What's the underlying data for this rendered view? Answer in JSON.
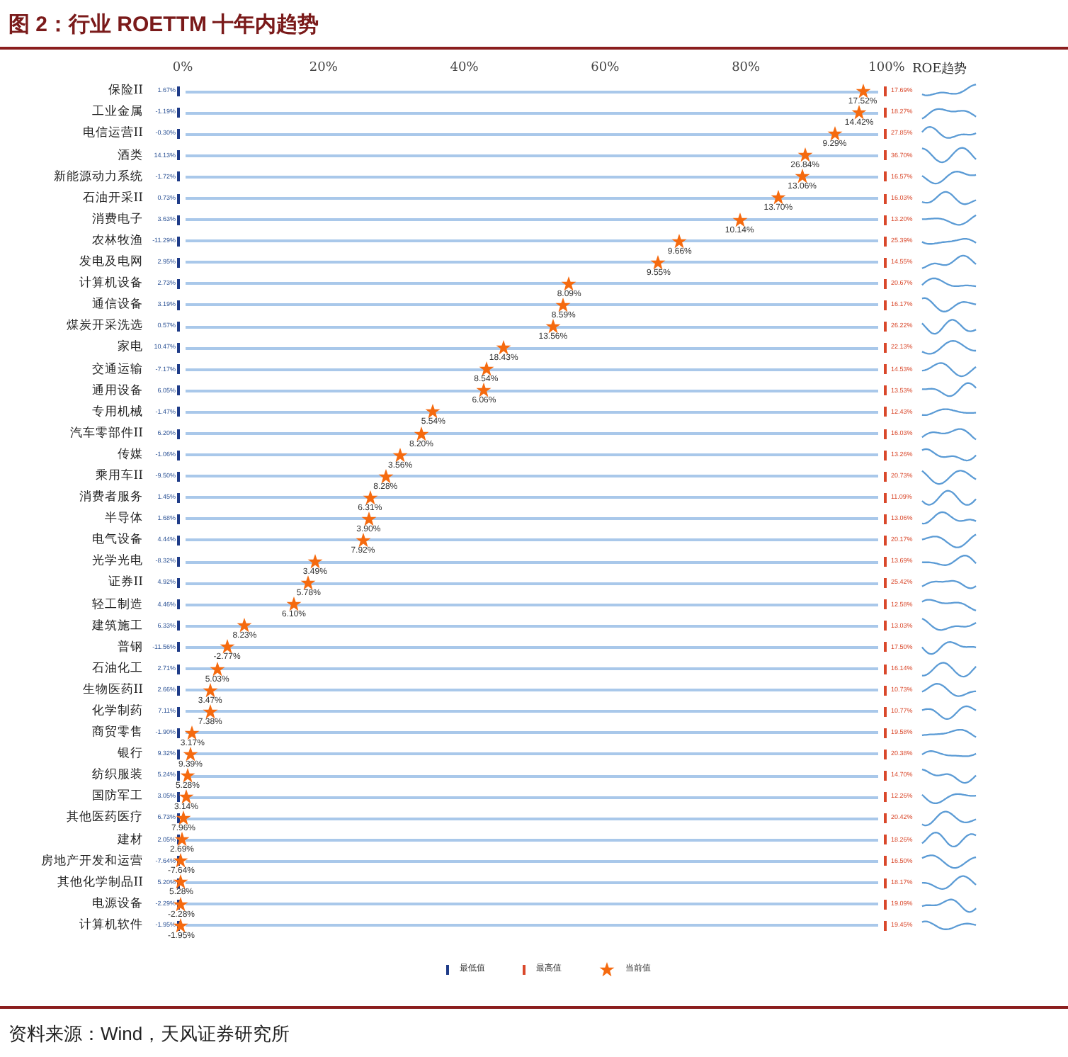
{
  "title": "图 2：行业 ROETTM 十年内趋势",
  "axis_ticks": [
    "0%",
    "20%",
    "40%",
    "60%",
    "80%",
    "100%"
  ],
  "trend_header": "ROE趋势",
  "rows": [
    {
      "name": "保险II",
      "min": "1.67%",
      "max": "17.69%",
      "level": 0.97,
      "current": "17.52%"
    },
    {
      "name": "工业金属",
      "min": "-1.19%",
      "max": "18.27%",
      "level": 0.965,
      "current": "14.42%"
    },
    {
      "name": "电信运营II",
      "min": "-0.30%",
      "max": "27.85%",
      "level": 0.93,
      "current": "9.29%"
    },
    {
      "name": "酒类",
      "min": "14.13%",
      "max": "36.70%",
      "level": 0.888,
      "current": "26.84%"
    },
    {
      "name": "新能源动力系统",
      "min": "-1.72%",
      "max": "16.57%",
      "level": 0.884,
      "current": "13.06%"
    },
    {
      "name": "石油开采II",
      "min": "0.73%",
      "max": "16.03%",
      "level": 0.85,
      "current": "13.70%"
    },
    {
      "name": "消费电子",
      "min": "3.63%",
      "max": "13.20%",
      "level": 0.795,
      "current": "10.14%"
    },
    {
      "name": "农林牧渔",
      "min": "-11.29%",
      "max": "25.39%",
      "level": 0.71,
      "current": "9.66%"
    },
    {
      "name": "发电及电网",
      "min": "2.95%",
      "max": "14.55%",
      "level": 0.68,
      "current": "9.55%"
    },
    {
      "name": "计算机设备",
      "min": "2.73%",
      "max": "20.67%",
      "level": 0.553,
      "current": "8.09%"
    },
    {
      "name": "通信设备",
      "min": "3.19%",
      "max": "16.17%",
      "level": 0.545,
      "current": "8.59%"
    },
    {
      "name": "煤炭开采洗选",
      "min": "0.57%",
      "max": "26.22%",
      "level": 0.53,
      "current": "13.56%"
    },
    {
      "name": "家电",
      "min": "10.47%",
      "max": "22.13%",
      "level": 0.46,
      "current": "18.43%"
    },
    {
      "name": "交通运输",
      "min": "-7.17%",
      "max": "14.53%",
      "level": 0.435,
      "current": "8.54%"
    },
    {
      "name": "通用设备",
      "min": "6.05%",
      "max": "13.53%",
      "level": 0.432,
      "current": "6.06%"
    },
    {
      "name": "专用机械",
      "min": "-1.47%",
      "max": "12.43%",
      "level": 0.36,
      "current": "5.54%"
    },
    {
      "name": "汽车零部件II",
      "min": "6.20%",
      "max": "16.03%",
      "level": 0.343,
      "current": "8.20%"
    },
    {
      "name": "传媒",
      "min": "-1.06%",
      "max": "13.26%",
      "level": 0.313,
      "current": "3.56%"
    },
    {
      "name": "乘用车II",
      "min": "-9.50%",
      "max": "20.73%",
      "level": 0.292,
      "current": "8.28%"
    },
    {
      "name": "消费者服务",
      "min": "1.45%",
      "max": "11.09%",
      "level": 0.27,
      "current": "6.31%"
    },
    {
      "name": "半导体",
      "min": "1.68%",
      "max": "13.06%",
      "level": 0.268,
      "current": "3.90%"
    },
    {
      "name": "电气设备",
      "min": "4.44%",
      "max": "20.17%",
      "level": 0.26,
      "current": "7.92%"
    },
    {
      "name": "光学光电",
      "min": "-8.32%",
      "max": "13.69%",
      "level": 0.192,
      "current": "3.49%"
    },
    {
      "name": "证券II",
      "min": "4.92%",
      "max": "25.42%",
      "level": 0.183,
      "current": "5.78%"
    },
    {
      "name": "轻工制造",
      "min": "4.46%",
      "max": "12.58%",
      "level": 0.162,
      "current": "6.10%"
    },
    {
      "name": "建筑施工",
      "min": "6.33%",
      "max": "13.03%",
      "level": 0.092,
      "current": "8.23%"
    },
    {
      "name": "普钢",
      "min": "-11.56%",
      "max": "17.50%",
      "level": 0.067,
      "current": "-2.77%"
    },
    {
      "name": "石油化工",
      "min": "2.71%",
      "max": "16.14%",
      "level": 0.053,
      "current": "5.03%"
    },
    {
      "name": "生物医药II",
      "min": "2.66%",
      "max": "10.73%",
      "level": 0.043,
      "current": "3.47%"
    },
    {
      "name": "化学制药",
      "min": "7.11%",
      "max": "10.77%",
      "level": 0.043,
      "current": "7.38%"
    },
    {
      "name": "商贸零售",
      "min": "-1.90%",
      "max": "19.58%",
      "level": 0.018,
      "current": "3.17%"
    },
    {
      "name": "银行",
      "min": "9.32%",
      "max": "20.38%",
      "level": 0.015,
      "current": "9.39%"
    },
    {
      "name": "纺织服装",
      "min": "5.24%",
      "max": "14.70%",
      "level": 0.011,
      "current": "5.28%"
    },
    {
      "name": "国防军工",
      "min": "3.05%",
      "max": "12.26%",
      "level": 0.009,
      "current": "3.14%"
    },
    {
      "name": "其他医药医疗",
      "min": "6.73%",
      "max": "20.42%",
      "level": 0.005,
      "current": "7.96%"
    },
    {
      "name": "建材",
      "min": "2.05%",
      "max": "18.26%",
      "level": 0.003,
      "current": "2.69%"
    },
    {
      "name": "房地产开发和运营",
      "min": "-7.64%",
      "max": "16.50%",
      "level": 0.002,
      "current": "-7.64%"
    },
    {
      "name": "其他化学制品II",
      "min": "5.20%",
      "max": "18.17%",
      "level": 0.002,
      "current": "5.28%"
    },
    {
      "name": "电源设备",
      "min": "-2.29%",
      "max": "19.09%",
      "level": 0.002,
      "current": "-2.28%"
    },
    {
      "name": "计算机软件",
      "min": "-1.95%",
      "max": "19.45%",
      "level": 0.002,
      "current": "-1.95%"
    }
  ],
  "legend": [
    {
      "kind": "min",
      "label": "最低值"
    },
    {
      "kind": "max",
      "label": "最高值"
    },
    {
      "kind": "current",
      "label": "当前值"
    }
  ],
  "source": "资料来源：Wind，天风证券研究所"
}
